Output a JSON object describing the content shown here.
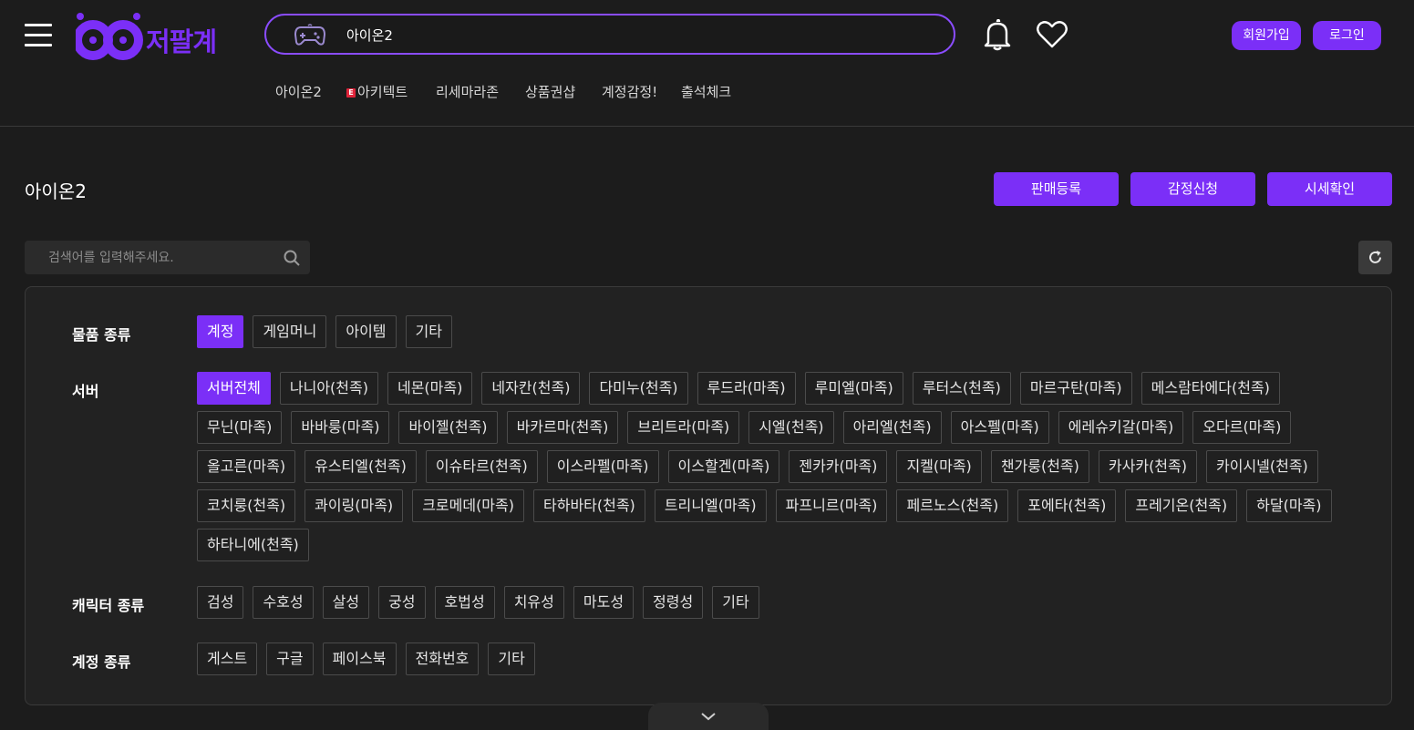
{
  "header": {
    "logo_text": "저팔계",
    "search_value": "아이온2",
    "signup_label": "회원가입",
    "login_label": "로그인",
    "brand_color": "#7b2ff7"
  },
  "quicknav": [
    {
      "label": "아이온2"
    },
    {
      "label": "아키텍트",
      "badge": "E"
    },
    {
      "label": "리세마라존"
    },
    {
      "label": "상품권샵"
    },
    {
      "label": "계정감정!"
    },
    {
      "label": "출석체크"
    }
  ],
  "page": {
    "title": "아이온2",
    "actions": [
      "판매등록",
      "감정신청",
      "시세확인"
    ],
    "search_placeholder": "검색어를 입력해주세요."
  },
  "filters": [
    {
      "label": "물품 종류",
      "options": [
        "계정",
        "게임머니",
        "아이템",
        "기타"
      ],
      "selected": 0
    },
    {
      "label": "서버",
      "options": [
        "서버전체",
        "나니아(천족)",
        "네몬(마족)",
        "네자칸(천족)",
        "다미누(천족)",
        "루드라(마족)",
        "루미엘(마족)",
        "루터스(천족)",
        "마르구탄(마족)",
        "메스람타에다(천족)",
        "무닌(마족)",
        "바바룽(마족)",
        "바이젤(천족)",
        "바카르마(천족)",
        "브리트라(마족)",
        "시엘(천족)",
        "아리엘(천족)",
        "아스펠(마족)",
        "에레슈키갈(마족)",
        "오다르(마족)",
        "올고른(마족)",
        "유스티엘(천족)",
        "이슈타르(천족)",
        "이스라펠(마족)",
        "이스할겐(마족)",
        "젠카카(마족)",
        "지켈(마족)",
        "챈가룽(천족)",
        "카사카(천족)",
        "카이시넬(천족)",
        "코치룽(천족)",
        "콰이링(마족)",
        "크로메데(마족)",
        "타하바타(천족)",
        "트리니엘(마족)",
        "파프니르(마족)",
        "페르노스(천족)",
        "포에타(천족)",
        "프레기온(천족)",
        "하달(마족)",
        "하타니에(천족)"
      ],
      "selected": 0
    },
    {
      "label": "캐릭터 종류",
      "options": [
        "검성",
        "수호성",
        "살성",
        "궁성",
        "호법성",
        "치유성",
        "마도성",
        "정령성",
        "기타"
      ],
      "selected": -1
    },
    {
      "label": "계정 종류",
      "options": [
        "게스트",
        "구글",
        "페이스북",
        "전화번호",
        "기타"
      ],
      "selected": -1
    }
  ]
}
